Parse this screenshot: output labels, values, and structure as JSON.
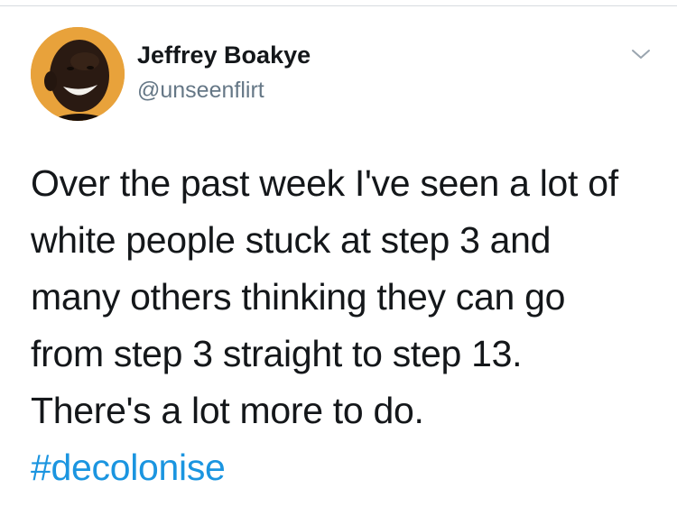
{
  "tweet": {
    "author": {
      "display_name": "Jeffrey Boakye",
      "handle": "@unseenflirt"
    },
    "text_lines": [
      "Over the past week I've seen a lot of",
      "white people stuck at step 3 and",
      "many others thinking they can go",
      "from step 3 straight to step 13.",
      "There's a lot more to do."
    ],
    "hashtag": "#decolonise"
  },
  "colors": {
    "text": "#14171a",
    "secondary_text": "#657786",
    "link": "#1b95e0",
    "avatar_background": "#e8a23b"
  }
}
